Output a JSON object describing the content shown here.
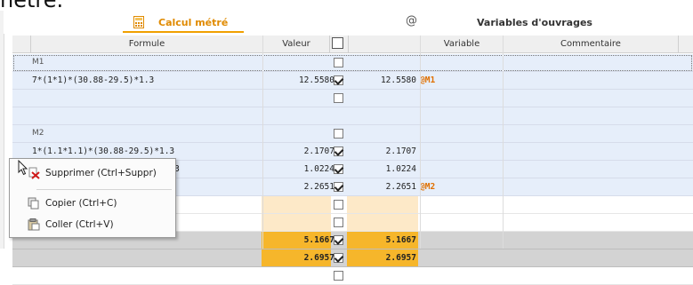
{
  "top_cut_text": "nètre.",
  "tabs": [
    {
      "label": "Calcul métré",
      "active": true
    },
    {
      "label": "Variables d'ouvrages",
      "active": false
    }
  ],
  "columns": {
    "formule": "Formule",
    "valeur": "Valeur",
    "variable": "Variable",
    "commentaire": "Commentaire"
  },
  "rows": [
    {
      "kind": "group",
      "formule": "M1",
      "check": false
    },
    {
      "kind": "data",
      "formule": "7*(1*1)*(30.88-29.5)*1.3",
      "valeur": "12.5580",
      "check": true,
      "value2": "12.5580",
      "variable": "@M1"
    },
    {
      "kind": "empty",
      "check": false
    },
    {
      "kind": "group",
      "formule": "M2",
      "check": false
    },
    {
      "kind": "data",
      "formule": "1*(1.1*1.1)*(30.88-29.5)*1.3",
      "valeur": "2.1707",
      "check": true,
      "value2": "2.1707",
      "variable": ""
    },
    {
      "kind": "data",
      "formule": "1*(1.1*1.1)*(30.88-30.23)*1.3",
      "valeur": "1.0224",
      "check": true,
      "value2": "1.0224",
      "variable": ""
    },
    {
      "kind": "data",
      "formule": "1*(1.1*1.1)*(30.88-29.5)*1.3",
      "valeur": "2.2651",
      "check": true,
      "value2": "2.2651",
      "variable": "@M2"
    },
    {
      "kind": "peach",
      "check": false
    },
    {
      "kind": "peach",
      "check": false
    },
    {
      "kind": "sum",
      "valeur": "5.1667",
      "check": true,
      "value2": "5.1667"
    },
    {
      "kind": "sum",
      "valeur": "2.6957",
      "check": true,
      "value2": "2.6957"
    },
    {
      "kind": "empty-tail",
      "check": false
    }
  ],
  "context_menu": {
    "items": [
      {
        "label": "Supprimer (Ctrl+Suppr)",
        "icon": "delete-icon"
      },
      {
        "label": "Copier (Ctrl+C)",
        "icon": "copy-icon"
      },
      {
        "label": "Coller (Ctrl+V)",
        "icon": "paste-icon"
      }
    ]
  },
  "colors": {
    "accent": "#f0a000",
    "variable": "#e07000",
    "row_blue": "#e6eefa",
    "peach": "#fde9c8",
    "orange": "#f6b62b"
  }
}
